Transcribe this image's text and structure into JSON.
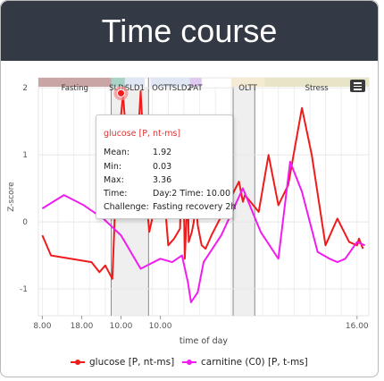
{
  "header": {
    "title": "Time course"
  },
  "chart_data": {
    "type": "line",
    "title": "",
    "xlabel": "time of day",
    "ylabel": "Z-score",
    "xlim": [
      7.9,
      16.3
    ],
    "ylim": [
      -1.4,
      2.15
    ],
    "x_ticks": [
      {
        "value": 8.0,
        "label": "8.00"
      },
      {
        "value": 9.0,
        "label": "18.00"
      },
      {
        "value": 10.0,
        "label": "10.00"
      },
      {
        "value": 11.0,
        "label": "10.00"
      },
      {
        "value": 16.0,
        "label": "16.00"
      }
    ],
    "y_ticks": [
      -1,
      0,
      1,
      2
    ],
    "grid": true,
    "legend_position": "bottom",
    "challenge_bands": [
      {
        "label": "Fasting",
        "start": 7.9,
        "end": 9.75,
        "color": "#c9a5a5"
      },
      {
        "label": "SLDr",
        "start": 9.75,
        "end": 10.1,
        "color": "#a8d4c8"
      },
      {
        "label": "SLD1",
        "start": 10.1,
        "end": 10.6,
        "color": "#dfe7f4"
      },
      {
        "label": "OGTT",
        "start": 10.75,
        "end": 11.35,
        "color": "#dfe7f4"
      },
      {
        "label": "SLD2",
        "start": 11.35,
        "end": 11.75,
        "color": "#dfe7f4"
      },
      {
        "label": "PAT",
        "start": 11.75,
        "end": 12.05,
        "color": "#e0c9f0"
      },
      {
        "label": "OLTT",
        "start": 12.8,
        "end": 13.65,
        "color": "#f5ead2"
      },
      {
        "label": "Stress",
        "start": 13.65,
        "end": 16.3,
        "color": "#e8e4c8"
      }
    ],
    "shaded_regions": [
      {
        "start": 9.75,
        "end": 10.7
      },
      {
        "start": 12.85,
        "end": 13.4
      }
    ],
    "series": [
      {
        "name": "glucose [P, nt-ms]",
        "color": "#ee1c1c",
        "x": [
          8.0,
          8.22,
          9.25,
          9.45,
          9.6,
          9.78,
          9.9,
          10.05,
          10.2,
          10.27,
          10.35,
          10.38,
          10.5,
          10.65,
          10.72,
          11.05,
          11.2,
          11.35,
          11.5,
          11.52,
          11.6,
          11.62,
          11.7,
          11.72,
          11.8,
          11.85,
          11.9,
          11.95,
          12.05,
          12.15,
          12.3,
          13.0,
          13.1,
          13.15,
          13.5,
          13.75,
          14.0,
          14.25,
          14.6,
          14.85,
          15.2,
          15.5,
          15.8,
          16.0,
          16.05,
          16.15
        ],
        "y": [
          -0.2,
          -0.5,
          -0.6,
          -0.75,
          -0.65,
          -0.85,
          0.95,
          1.9,
          0.8,
          1.25,
          0.5,
          0.7,
          1.95,
          0.3,
          -0.15,
          0.75,
          -0.35,
          -0.25,
          -0.1,
          0.35,
          0.25,
          -0.55,
          0.5,
          -0.3,
          -0.15,
          0.0,
          0.35,
          -0.05,
          -0.35,
          -0.4,
          -0.2,
          0.6,
          0.3,
          0.4,
          0.15,
          1.0,
          0.25,
          0.55,
          1.7,
          1.0,
          -0.35,
          0.05,
          -0.3,
          -0.35,
          -0.25,
          -0.4
        ]
      },
      {
        "name": "carnitine (C0) [P, t-ms]",
        "color": "#f01cf0",
        "x": [
          8.0,
          8.55,
          9.05,
          9.55,
          10.0,
          10.5,
          11.0,
          11.3,
          11.55,
          11.7,
          11.78,
          11.95,
          12.1,
          12.55,
          13.1,
          13.55,
          14.0,
          14.3,
          14.6,
          15.0,
          15.3,
          15.5,
          15.7,
          16.0,
          16.2
        ],
        "y": [
          0.2,
          0.4,
          0.25,
          0.05,
          -0.2,
          -0.7,
          -0.55,
          -0.6,
          -0.5,
          -0.9,
          -1.2,
          -1.05,
          -0.6,
          -0.2,
          0.5,
          -0.15,
          -0.55,
          0.9,
          0.45,
          -0.45,
          -0.55,
          -0.6,
          -0.55,
          -0.3,
          -0.35
        ]
      }
    ],
    "highlight_point": {
      "series": "glucose [P, nt-ms]",
      "x": 10.0,
      "y": 1.92
    },
    "tooltip": {
      "title": "glucose [P, nt-ms]",
      "rows": [
        {
          "label": "Mean:",
          "value": "1.92"
        },
        {
          "label": "Min:",
          "value": "0.03"
        },
        {
          "label": "Max:",
          "value": "3.36"
        },
        {
          "label": "Time:",
          "value": "Day:2 Time: 10.00"
        },
        {
          "label": "Challenge:",
          "value": "Fasting recovery 2h"
        }
      ]
    }
  }
}
